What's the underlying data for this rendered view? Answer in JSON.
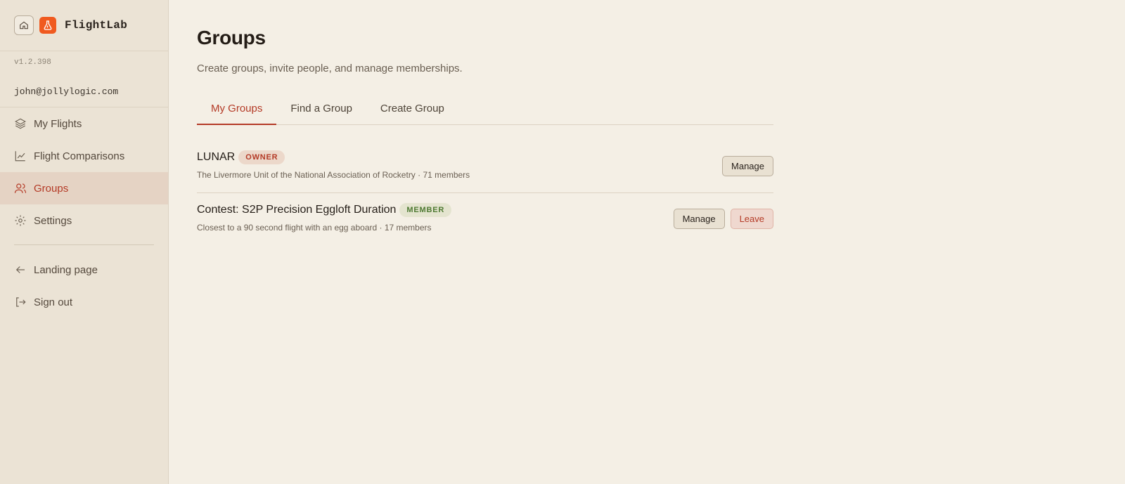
{
  "app": {
    "name": "FlightLab",
    "version": "v1.2.398",
    "user_email": "john@jollylogic.com"
  },
  "sidebar": {
    "items": [
      {
        "label": "My Flights",
        "icon": "layers-icon"
      },
      {
        "label": "Flight Comparisons",
        "icon": "chart-line-icon"
      },
      {
        "label": "Groups",
        "icon": "users-icon",
        "active": true
      },
      {
        "label": "Settings",
        "icon": "gear-icon"
      }
    ],
    "footer_items": [
      {
        "label": "Landing page",
        "icon": "arrow-left-icon"
      },
      {
        "label": "Sign out",
        "icon": "sign-out-icon"
      }
    ]
  },
  "page": {
    "title": "Groups",
    "subtitle": "Create groups, invite people, and manage memberships."
  },
  "tabs": [
    {
      "label": "My Groups",
      "active": true
    },
    {
      "label": "Find a Group"
    },
    {
      "label": "Create Group"
    }
  ],
  "groups": [
    {
      "name": "LUNAR",
      "role": "OWNER",
      "description": "The Livermore Unit of the National Association of Rocketry · 71 members",
      "actions": {
        "manage": "Manage"
      }
    },
    {
      "name": "Contest: S2P Precision Eggloft Duration",
      "role": "MEMBER",
      "description": "Closest to a 90 second flight with an egg aboard · 17 members",
      "actions": {
        "manage": "Manage",
        "leave": "Leave"
      }
    }
  ],
  "colors": {
    "accent": "#b43a26",
    "logo": "#f05a1f",
    "member_badge": "#4f7a33",
    "background": "#f4efe5",
    "sidebar": "#ebe3d5"
  }
}
